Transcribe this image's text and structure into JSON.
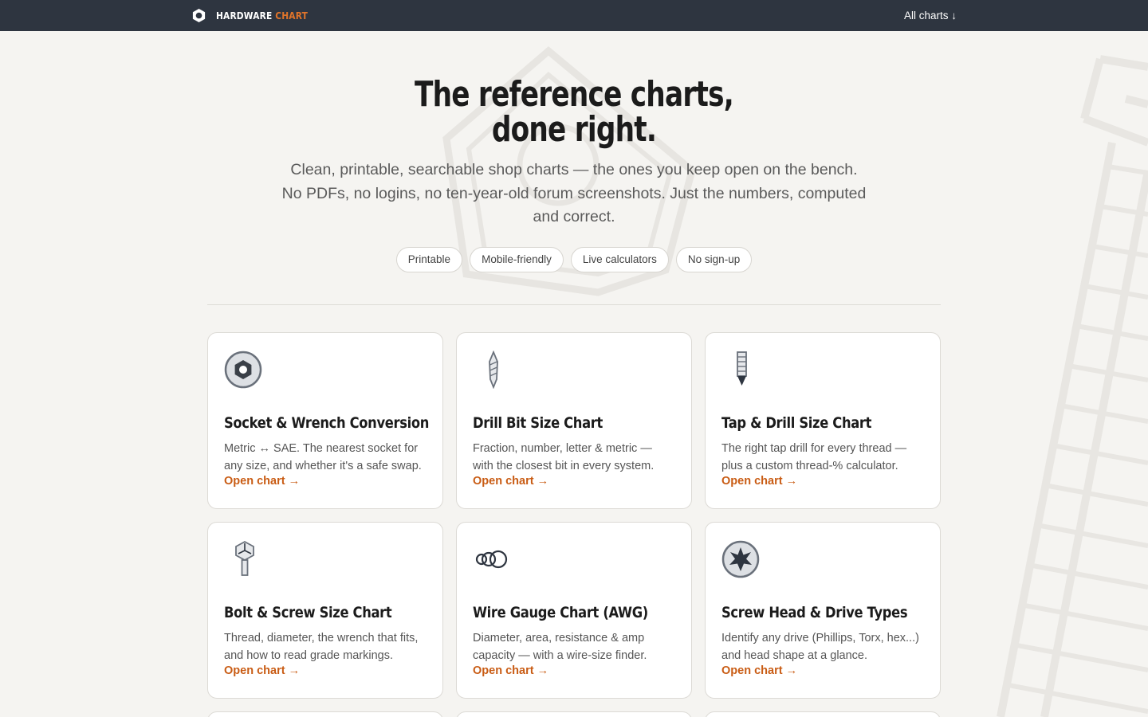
{
  "header": {
    "brand_primary": "HARDWARE",
    "brand_accent": "CHART",
    "nav_label": "All charts ↓",
    "brand_icon": "hex-nut-icon"
  },
  "hero": {
    "title_line1": "The reference charts,",
    "title_line2": "done right.",
    "subtitle": "Clean, printable, searchable shop charts — the ones you keep open on the bench. No PDFs, no logins, no ten-year-old forum screenshots. Just the numbers, computed and correct.",
    "chips": [
      "Printable",
      "Mobile-friendly",
      "Live calculators",
      "No sign-up"
    ]
  },
  "cards": [
    {
      "title": "Socket & Wrench Conversion",
      "desc": "Metric ↔ SAE. The nearest socket for any size, and whether it's a safe swap.",
      "link": "Open chart →",
      "icon": "socket-icon"
    },
    {
      "title": "Drill Bit Size Chart",
      "desc": "Fraction, number, letter & metric — with the closest bit in every system.",
      "link": "Open chart →",
      "icon": "drill-bit-icon"
    },
    {
      "title": "Tap & Drill Size Chart",
      "desc": "The right tap drill for every thread — plus a custom thread-% calculator.",
      "link": "Open chart →",
      "icon": "tap-icon"
    },
    {
      "title": "Bolt & Screw Size Chart",
      "desc": "Thread, diameter, the wrench that fits, and how to read grade markings.",
      "link": "Open chart →",
      "icon": "bolt-icon"
    },
    {
      "title": "Wire Gauge Chart (AWG)",
      "desc": "Diameter, area, resistance & amp capacity — with a wire-size finder.",
      "link": "Open chart →",
      "icon": "wire-gauge-icon"
    },
    {
      "title": "Screw Head & Drive Types",
      "desc": "Identify any drive (Phillips, Torx, hex...) and head shape at a glance.",
      "link": "Open chart →",
      "icon": "torx-drive-icon"
    }
  ],
  "colors": {
    "topbar": "#2e3540",
    "accent": "#e0742a",
    "link": "#c95c14",
    "background": "#f5f4f1"
  }
}
